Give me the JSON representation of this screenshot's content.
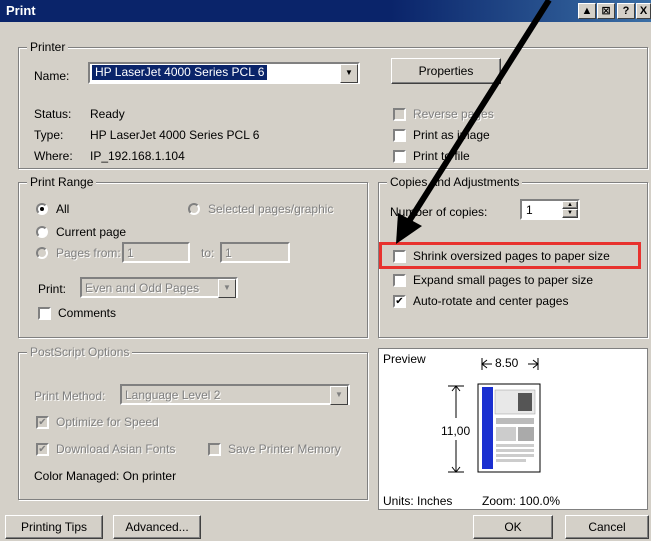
{
  "window": {
    "title": "Print",
    "buttons": [
      "▲",
      "⊠",
      "?",
      "X"
    ]
  },
  "printer": {
    "legend": "Printer",
    "name_label": "Name:",
    "name_value": "HP LaserJet 4000 Series PCL 6",
    "properties_label": "Properties",
    "status_label": "Status:",
    "status_value": "Ready",
    "type_label": "Type:",
    "type_value": "HP LaserJet 4000 Series PCL 6",
    "where_label": "Where:",
    "where_value": "IP_192.168.1.104",
    "reverse_pages": "Reverse pages",
    "print_as_image": "Print as image",
    "print_to_file": "Print to file"
  },
  "print_range": {
    "legend": "Print Range",
    "all": "All",
    "selected": "Selected pages/graphic",
    "current_page": "Current page",
    "pages_from": "Pages from:",
    "from_value": "1",
    "to_label": "to:",
    "to_value": "1",
    "print_label": "Print:",
    "print_value": "Even and Odd Pages",
    "comments": "Comments"
  },
  "copies": {
    "legend": "Copies and Adjustments",
    "number_label": "Number of copies:",
    "number_value": "1",
    "shrink": "Shrink oversized pages to paper size",
    "expand": "Expand small pages to paper size",
    "autorotate": "Auto-rotate and center pages"
  },
  "postscript": {
    "legend": "PostScript Options",
    "method_label": "Print Method:",
    "method_value": "Language Level 2",
    "optimize": "Optimize for Speed",
    "download_fonts": "Download Asian Fonts",
    "save_memory": "Save Printer Memory",
    "color_managed": "Color Managed:  On printer"
  },
  "preview": {
    "label": "Preview",
    "width": "8.50",
    "height": "11,00",
    "units": "Units: Inches",
    "zoom": "Zoom: 100.0%"
  },
  "footer": {
    "printing_tips": "Printing Tips",
    "advanced": "Advanced...",
    "ok": "OK",
    "cancel": "Cancel"
  },
  "colors": {
    "annotation_box": "#e8322e",
    "title_bar": "#0a246a"
  }
}
